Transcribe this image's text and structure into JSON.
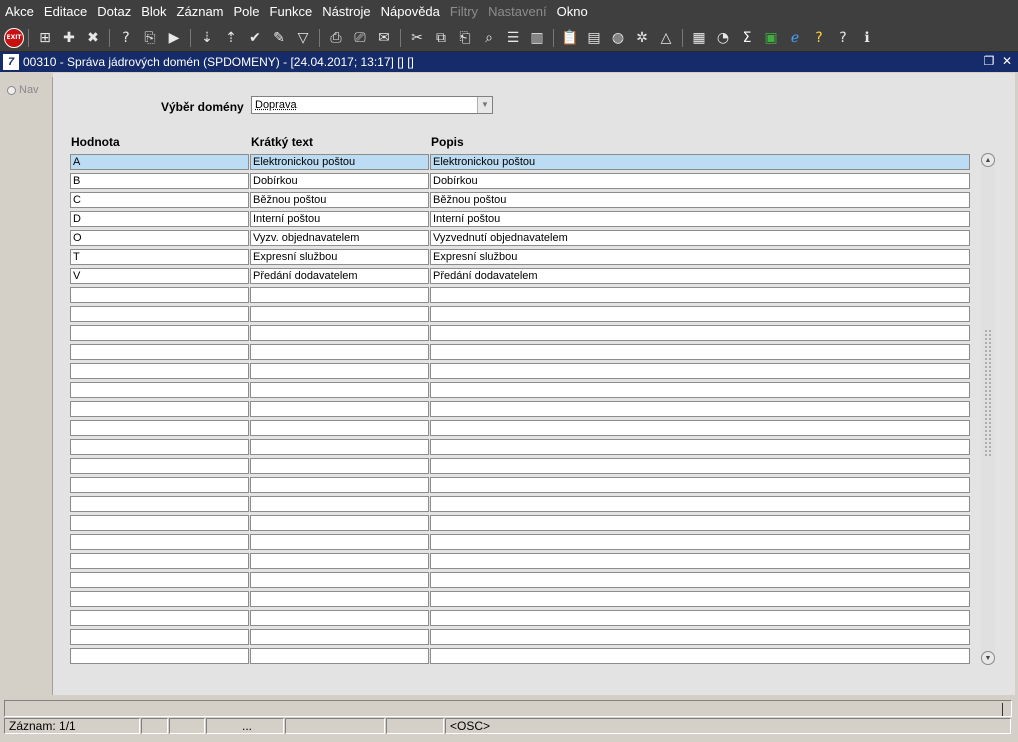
{
  "menu": [
    "Akce",
    "Editace",
    "Dotaz",
    "Blok",
    "Záznam",
    "Pole",
    "Funkce",
    "Nástroje",
    "Nápověda",
    "Filtry",
    "Nastavení",
    "Okno"
  ],
  "menu_disabled": [
    "Filtry",
    "Nastavení"
  ],
  "toolbar": {
    "exit_label": "EXIT",
    "icons": [
      "save-record-icon",
      "new-record-icon",
      "delete-record-icon",
      "sep",
      "query-icon",
      "enter-query-icon",
      "execute-query-icon",
      "sep",
      "sort-asc-icon",
      "sort-desc-icon",
      "accept-icon",
      "tools-icon",
      "filter-icon",
      "sep",
      "print-icon",
      "print-preview-icon",
      "mail-icon",
      "sep",
      "cut-icon",
      "copy-icon",
      "paste-icon",
      "find-icon",
      "list-icon",
      "columns-icon",
      "sep",
      "clipboard-icon",
      "document-icon",
      "globe-icon",
      "settings-wheel-icon",
      "triangle-icon",
      "sep",
      "chart-icon",
      "calendar-icon",
      "sum-icon",
      "excel-icon",
      "ie-icon",
      "help-mark-icon",
      "context-help-icon",
      "info-icon"
    ]
  },
  "window": {
    "icon_letter": "7",
    "title": "00310 - Správa jádrových domén (SPDOMENY) - [24.04.2017; 13:17]  [] []"
  },
  "nav": {
    "label": "Nav"
  },
  "domain_select": {
    "label": "Výběr domény",
    "value": "Doprava"
  },
  "columns": [
    "Hodnota",
    "Krátký text",
    "Popis"
  ],
  "rows": [
    [
      "A",
      "Elektronickou poštou",
      "Elektronickou poštou"
    ],
    [
      "B",
      "Dobírkou",
      "Dobírkou"
    ],
    [
      "C",
      "Běžnou poštou",
      "Běžnou poštou"
    ],
    [
      "D",
      "Interní poštou",
      "Interní poštou"
    ],
    [
      "O",
      "Vyzv. objednavatelem",
      "Vyzvednutí objednavatelem"
    ],
    [
      "T",
      "Expresní službou",
      "Expresní službou"
    ],
    [
      "V",
      "Předání dodavatelem",
      "Předání dodavatelem"
    ],
    [
      "",
      "",
      ""
    ],
    [
      "",
      "",
      ""
    ],
    [
      "",
      "",
      ""
    ],
    [
      "",
      "",
      ""
    ],
    [
      "",
      "",
      ""
    ],
    [
      "",
      "",
      ""
    ],
    [
      "",
      "",
      ""
    ],
    [
      "",
      "",
      ""
    ],
    [
      "",
      "",
      ""
    ],
    [
      "",
      "",
      ""
    ],
    [
      "",
      "",
      ""
    ],
    [
      "",
      "",
      ""
    ],
    [
      "",
      "",
      ""
    ],
    [
      "",
      "",
      ""
    ],
    [
      "",
      "",
      ""
    ],
    [
      "",
      "",
      ""
    ],
    [
      "",
      "",
      ""
    ],
    [
      "",
      "",
      ""
    ],
    [
      "",
      "",
      ""
    ],
    [
      "",
      "",
      ""
    ]
  ],
  "selected_row": 0,
  "status": {
    "record": "Záznam: 1/1",
    "f2": "",
    "f3": "",
    "f4": "...",
    "f5": "",
    "f6": "",
    "f7": "<OSC>"
  }
}
